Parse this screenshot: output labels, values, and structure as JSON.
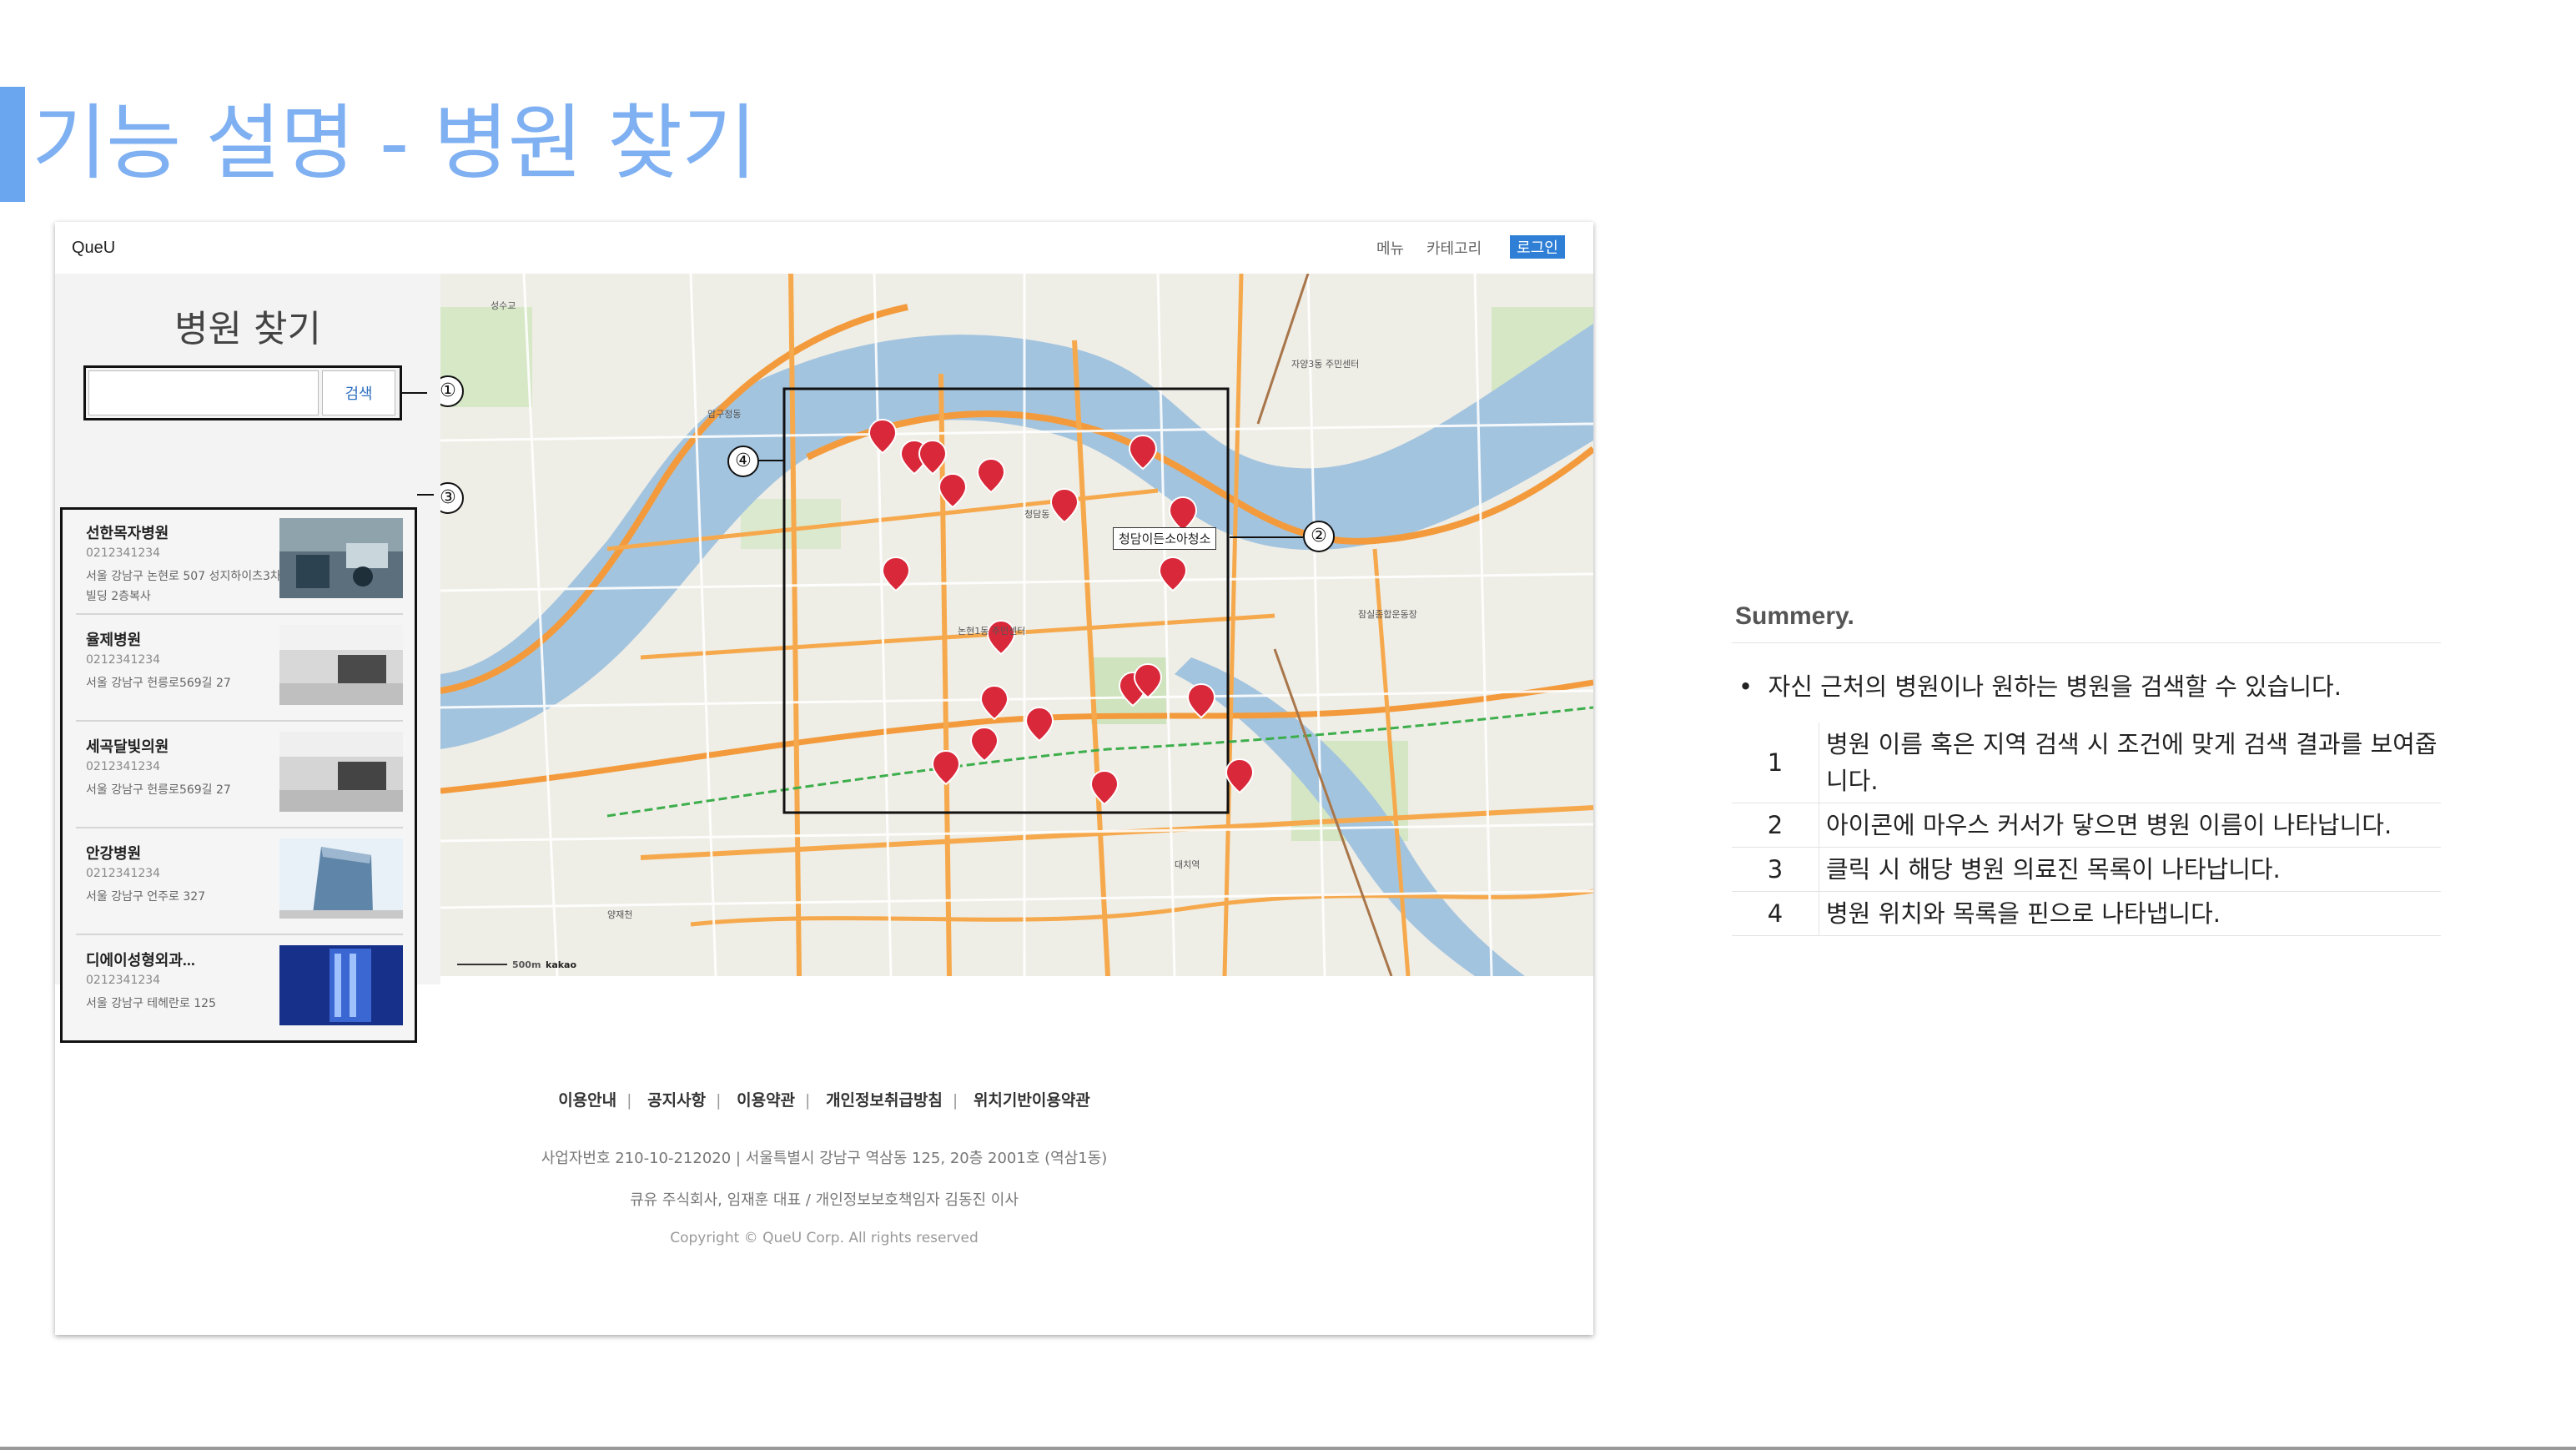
{
  "slide": {
    "title": "기능 설명 - 병원 찾기",
    "accent": "#7fb0f2"
  },
  "app": {
    "brand": "QueU",
    "nav": {
      "menu": "메뉴",
      "category": "카테고리",
      "login": "로그인"
    }
  },
  "sidebar": {
    "title": "병원 찾기",
    "search_button": "검색",
    "search_value": "",
    "hospitals": [
      {
        "name": "선한목자병원",
        "phone": "0212341234",
        "address": "서울 강남구 논현로 507 성지하이츠3차빌딩 2층복사",
        "photo": "office-interior"
      },
      {
        "name": "율제병원",
        "phone": "0212341234",
        "address": "서울 강남구 헌릉로569길 27",
        "photo": "lobby"
      },
      {
        "name": "세곡달빛의원",
        "phone": "0212341234",
        "address": "서울 강남구 헌릉로569길 27",
        "photo": "lobby"
      },
      {
        "name": "안강병원",
        "phone": "0212341234",
        "address": "서울 강남구 언주로 327",
        "photo": "building"
      },
      {
        "name": "디에이성형외과...",
        "phone": "0212341234",
        "address": "서울 강남구 테헤란로 125",
        "photo": "blue-tower"
      }
    ]
  },
  "map": {
    "tooltip": "청담이든소아청소",
    "callouts": [
      "①",
      "②",
      "③",
      "④"
    ],
    "scale_label": "500m",
    "provider": "kakao",
    "pin_color": "#d9283a"
  },
  "footer": {
    "links": [
      "이용안내",
      "공지사항",
      "이용약관",
      "개인정보취급방침",
      "위치기반이용약관"
    ],
    "separator": "|",
    "business": "사업자번호 210-10-212020   |   서울특별시 강남구 역삼동 125, 20층 2001호 (역삼1동)",
    "company": "큐유 주식회사, 임재훈 대표  /  개인정보보호책임자 김동진 이사",
    "copyright": "Copyright  ©  QueU Corp.   All rights reserved"
  },
  "summary": {
    "title": "Summery.",
    "bullet": "자신 근처의 병원이나 원하는 병원을 검색할 수 있습니다.",
    "rows": [
      {
        "num": "1",
        "text": "병원 이름 혹은 지역 검색 시 조건에 맞게 검색 결과를 보여줍니다."
      },
      {
        "num": "2",
        "text": "아이콘에 마우스 커서가 닿으면 병원 이름이 나타납니다."
      },
      {
        "num": "3",
        "text": "클릭 시 해당 병원 의료진 목록이 나타납니다."
      },
      {
        "num": "4",
        "text": "병원 위치와 목록을 핀으로 나타냅니다."
      }
    ]
  }
}
